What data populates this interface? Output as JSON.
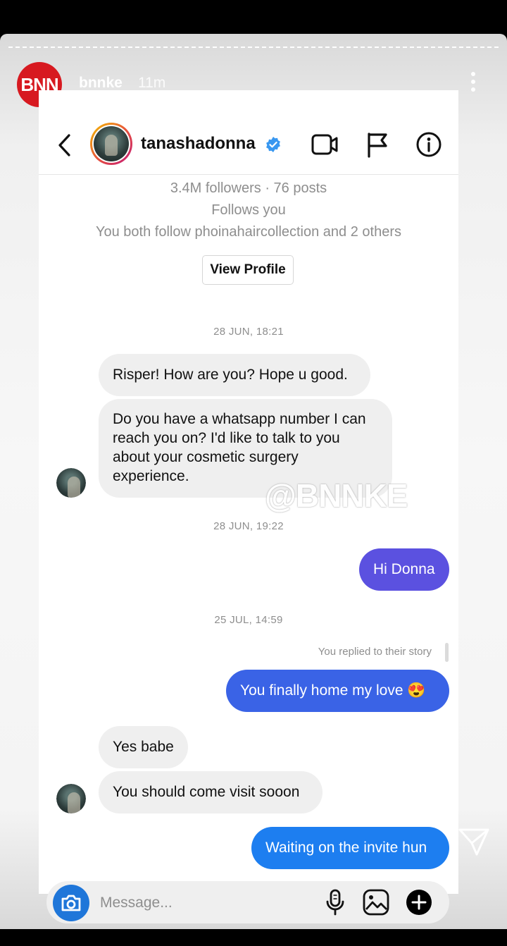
{
  "story": {
    "account": "bnnke",
    "time_ago": "11m",
    "logo_text": "BNN",
    "watermark": "@BNNKE"
  },
  "chat_header": {
    "username": "tanashadonna",
    "icons": [
      "back-arrow-icon",
      "video-call-icon",
      "flag-icon",
      "info-icon",
      "verified-badge-icon"
    ]
  },
  "profile_info": {
    "stats": "3.4M followers · 76 posts",
    "follows_you": "Follows you",
    "mutuals": "You both follow phoinahaircollection and 2 others",
    "view_profile_label": "View Profile"
  },
  "messages": [
    {
      "type": "timestamp",
      "text": "28 JUN, 18:21"
    },
    {
      "type": "received",
      "text": "Risper! How are you? Hope u good."
    },
    {
      "type": "received",
      "text": "Do you have a whatsapp number I can reach you on? I'd like to talk to you about your cosmetic surgery experience."
    },
    {
      "type": "timestamp",
      "text": "28 JUN, 19:22"
    },
    {
      "type": "sent",
      "text": "Hi Donna"
    },
    {
      "type": "timestamp",
      "text": "25 JUL, 14:59"
    },
    {
      "type": "note",
      "text": "You replied to their story"
    },
    {
      "type": "sent",
      "text": "You finally home my love 😍"
    },
    {
      "type": "received",
      "text": "Yes babe"
    },
    {
      "type": "received",
      "text": "You should come visit sooon"
    },
    {
      "type": "sent",
      "text": "Waiting on the invite hun"
    }
  ],
  "composer": {
    "placeholder": "Message...",
    "icons": [
      "camera-icon",
      "microphone-icon",
      "gallery-icon",
      "plus-icon",
      "send-icon"
    ]
  },
  "colors": {
    "sent_purple": "#5b51e0",
    "sent_blue_1": "#3a63e6",
    "sent_blue_2": "#1d7ef0",
    "camera_blue": "#1f76d9",
    "bnn_red": "#d71920"
  }
}
